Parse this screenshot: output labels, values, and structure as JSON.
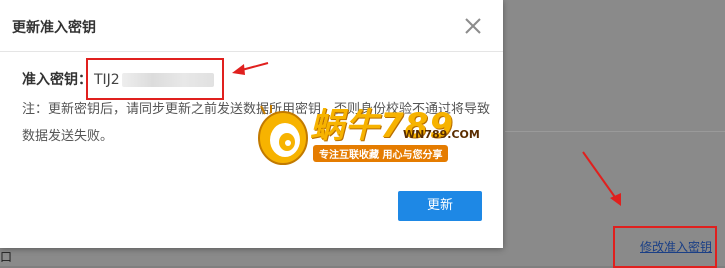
{
  "dialog": {
    "title": "更新准入密钥",
    "key_label": "准入密钥：",
    "key_value_visible": "TIJ2",
    "note": "注：更新密钥后，请同步更新之前发送数据所用密钥，否则身份校验不通过将导致数据发送失败。",
    "update_button": "更新",
    "close_icon": "close-icon"
  },
  "background": {
    "edit_key_link": "修改准入密钥",
    "left_edge_glyph": "口"
  },
  "watermark": {
    "brand": "蜗牛789",
    "domain": "WN789.COM",
    "slogan": "专注互联收藏 用心与您分享"
  },
  "colors": {
    "accent": "#1e88e5",
    "annotation_red": "#e0201e",
    "link": "#1a3f86",
    "watermark_orange": "#f7b300"
  }
}
